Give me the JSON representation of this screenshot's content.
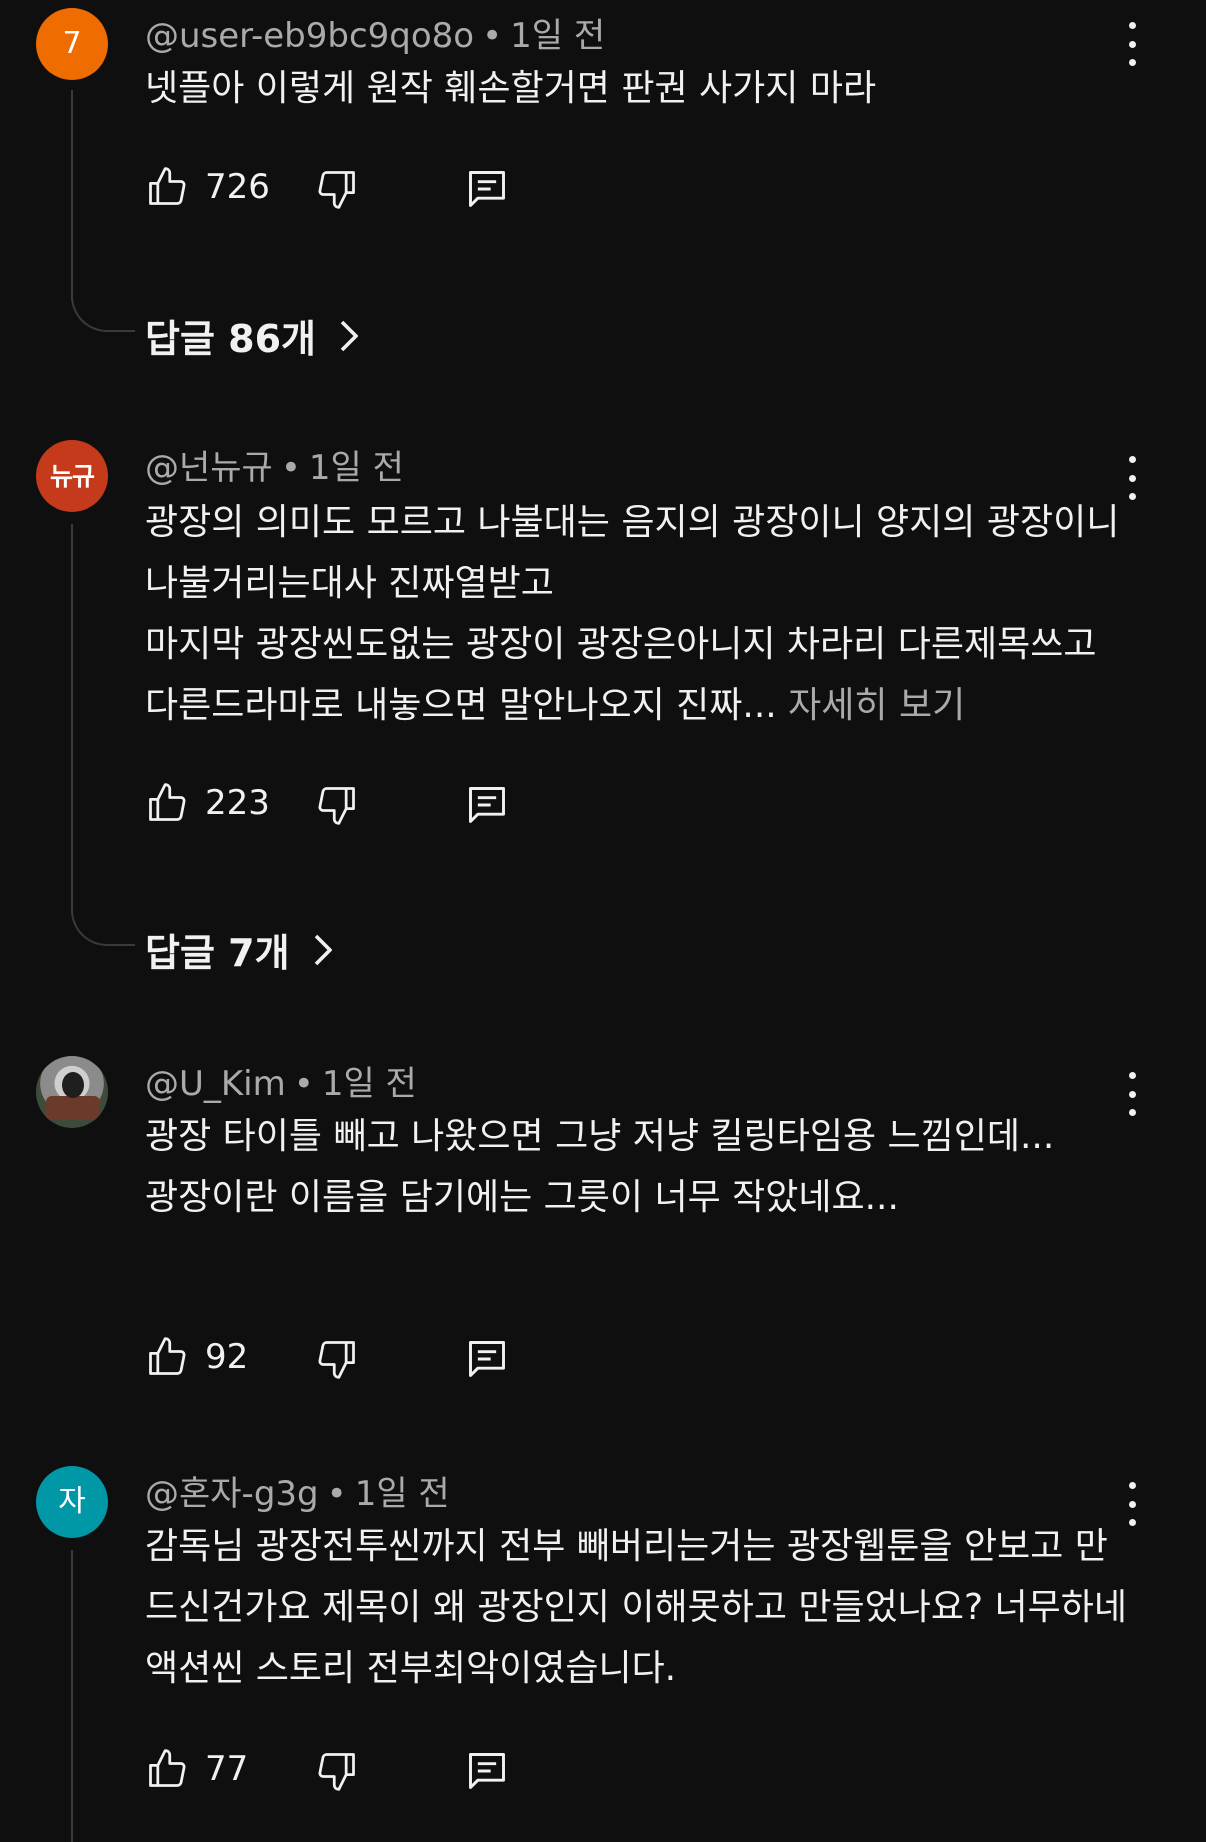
{
  "colors": {
    "background": "#0f0f0f",
    "text_primary": "#f1f1f1",
    "text_secondary": "#aaaaaa",
    "avatar_orange": "#ef6c00",
    "avatar_red": "#c43a1a",
    "avatar_teal": "#0097a7"
  },
  "comments": [
    {
      "avatar": "7",
      "user": "@user-eb9bc9qo8o",
      "separator": "•",
      "time": "1일 전",
      "text": "넷플아 이렇게 원작 훼손할거면 판권 사가지 마라",
      "more": "",
      "likes": "726",
      "replies_label": "답글 86개"
    },
    {
      "avatar": "뉴규",
      "user": "@넌뉴규",
      "separator": "•",
      "time": "1일 전",
      "text": "광장의 의미도 모르고 나불대는 음지의 광장이니 양지의 광장이니 나불거리는대사 진짜열받고\n마지막 광장씬도없는 광장이 광장은아니지 차라리 다른제목쓰고 다른드라마로 내놓으면 말안나오지 진짜... ",
      "more": "자세히 보기",
      "likes": "223",
      "replies_label": "답글 7개"
    },
    {
      "avatar": "",
      "user": "@U_Kim",
      "separator": "•",
      "time": "1일 전",
      "text": "광장 타이틀 빼고 나왔으면 그냥 저냥 킬링타임용 느낌인데...\n광장이란 이름을 담기에는 그릇이 너무 작았네요...",
      "more": "",
      "likes": "92",
      "replies_label": ""
    },
    {
      "avatar": "자",
      "user": "@혼자-g3g",
      "separator": "•",
      "time": "1일 전",
      "text": "감독님 광장전투씬까지 전부 빼버리는거는 광장웹툰을 안보고 만드신건가요 제목이 왜 광장인지 이해못하고 만들었나요? 너무하네 액션씬 스토리 전부최악이였습니다.",
      "more": "",
      "likes": "77",
      "replies_label": ""
    }
  ],
  "icons": {
    "like": "thumbs-up-icon",
    "dislike": "thumbs-down-icon",
    "reply": "reply-comment-icon",
    "menu": "more-vertical-icon",
    "chevron": "chevron-right-icon"
  }
}
